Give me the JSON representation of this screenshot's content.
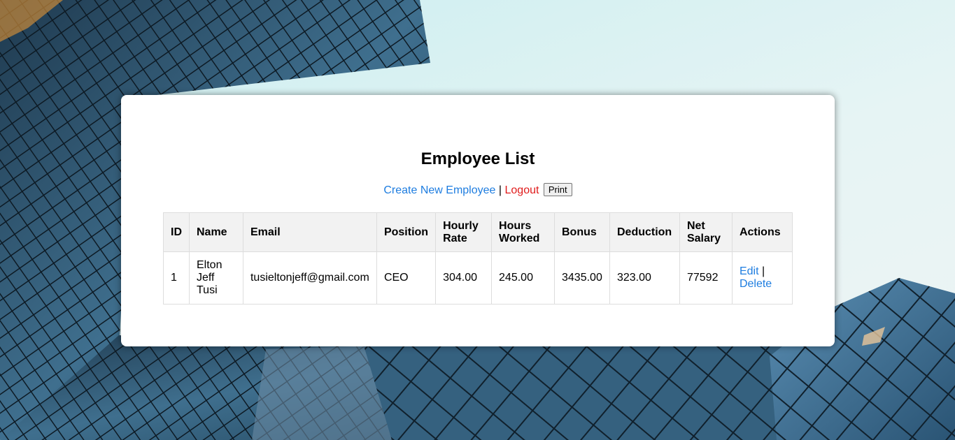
{
  "page": {
    "title": "Employee List"
  },
  "nav": {
    "create_label": "Create New Employee",
    "separator": "|",
    "logout_label": "Logout",
    "print_label": "Print"
  },
  "table": {
    "headers": {
      "id": "ID",
      "name": "Name",
      "email": "Email",
      "position": "Position",
      "hourly_rate": "Hourly Rate",
      "hours_worked": "Hours Worked",
      "bonus": "Bonus",
      "deduction": "Deduction",
      "net_salary": "Net Salary",
      "actions": "Actions"
    },
    "rows": [
      {
        "id": "1",
        "name": "Elton Jeff Tusi",
        "email": "tusieltonjeff@gmail.com",
        "position": "CEO",
        "hourly_rate": "304.00",
        "hours_worked": "245.00",
        "bonus": "3435.00",
        "deduction": "323.00",
        "net_salary": "77592",
        "edit_label": "Edit",
        "action_separator": "|",
        "delete_label": "Delete"
      }
    ]
  },
  "colors": {
    "link": "#1e7de0",
    "logout": "#e01b1b",
    "header_bg": "#f2f2f2"
  }
}
